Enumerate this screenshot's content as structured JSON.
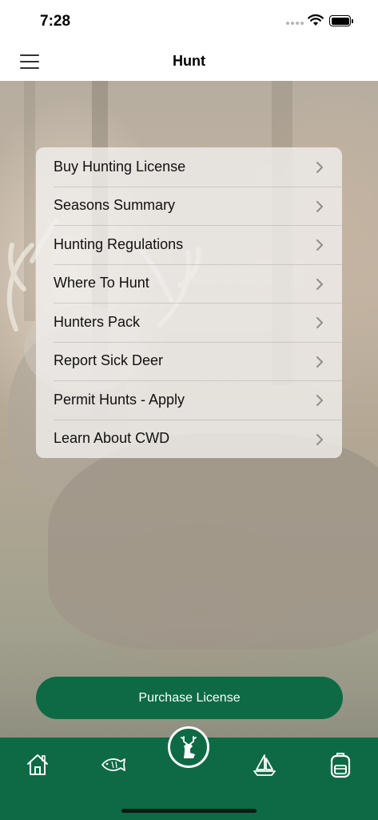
{
  "status_bar": {
    "time": "7:28"
  },
  "nav_bar": {
    "title": "Hunt"
  },
  "menu": {
    "items": [
      {
        "label": "Buy Hunting License"
      },
      {
        "label": "Seasons Summary"
      },
      {
        "label": "Hunting Regulations"
      },
      {
        "label": "Where To Hunt"
      },
      {
        "label": "Hunters Pack"
      },
      {
        "label": "Report Sick Deer"
      },
      {
        "label": "Permit Hunts - Apply"
      },
      {
        "label": "Learn About CWD"
      }
    ]
  },
  "purchase_button": {
    "label": "Purchase License"
  },
  "tab_bar": {
    "tabs": [
      {
        "icon": "home-icon"
      },
      {
        "icon": "fish-icon"
      },
      {
        "icon": "deer-icon",
        "selected": true
      },
      {
        "icon": "sailboat-icon"
      },
      {
        "icon": "backpack-icon"
      }
    ]
  },
  "colors": {
    "brand_green": "#0e6a45",
    "card_bg": "#f2f1f0"
  }
}
